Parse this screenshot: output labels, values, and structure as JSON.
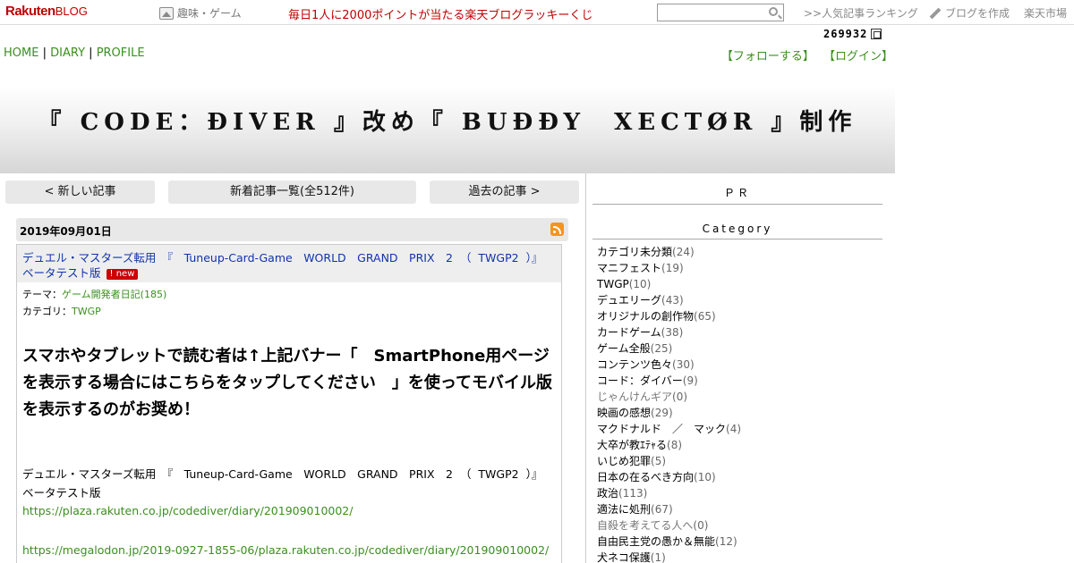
{
  "topbar": {
    "logo_main": "Rakuten",
    "logo_sub": "BLOG",
    "genre": "趣味・ゲーム",
    "promo": "毎日1人に2000ポイントが当たる楽天ブログラッキーくじ",
    "search_placeholder": "",
    "ranking": ">>人気記事ランキング",
    "create": "ブログを作成",
    "market": "楽天市場"
  },
  "counter": "269932",
  "nav": {
    "home": "HOME",
    "diary": "DIARY",
    "profile": "PROFILE",
    "sep": "|",
    "follow": "【フォローする】",
    "login": "【ログイン】"
  },
  "banner": {
    "title": "『 CODE：ÐIVER 』改め『 BUÐÐY　XECTØR 』制作"
  },
  "pagenav": {
    "newer": "< 新しい記事",
    "list": "新着記事一覧(全512件)",
    "older": "過去の記事 >"
  },
  "article": {
    "date": "2019年09月01日",
    "title": "デュエル・マスターズ転用　『　Tuneup-Card-Game　WORLD　GRAND　PRIX　2 （ TWGP2 ）』　ベータテスト版",
    "badge": "new",
    "theme_label": "テーマ：",
    "theme": "ゲーム開発者日記(185)",
    "category_label": "カテゴリ：",
    "category": "TWGP",
    "headline": "スマホやタブレットで読む者は↑上記バナー「　SmartPhone用ページを表示する場合にはこちらをタップしてください　」を使ってモバイル版を表示するのがお奨め！",
    "body": "デュエル・マスターズ転用　『　Tuneup-Card-Game　WORLD　GRAND　PRIX　2 （ TWGP2 ）』　ベータテスト版",
    "link1": "https://plaza.rakuten.co.jp/codediver/diary/201909010002/",
    "link2": "https://megalodon.jp/2019-0927-1855-06/plaza.rakuten.co.jp/codediver/diary/201909010002/"
  },
  "sidebar": {
    "pr": "ＰＲ",
    "category_heading": "Category",
    "categories": [
      {
        "name": "カテゴリ未分類",
        "count": "(24)"
      },
      {
        "name": "マニフェスト",
        "count": "(19)"
      },
      {
        "name": "TWGP",
        "count": "(10)"
      },
      {
        "name": "デュエリーグ",
        "count": "(43)"
      },
      {
        "name": "オリジナルの創作物",
        "count": "(65)"
      },
      {
        "name": "カードゲーム",
        "count": "(38)"
      },
      {
        "name": "ゲーム全般",
        "count": "(25)"
      },
      {
        "name": "コンテンツ色々",
        "count": "(30)"
      },
      {
        "name": "コード：ダイバー",
        "count": "(9)"
      },
      {
        "name": "じゃんけんギア",
        "count": "(0)"
      },
      {
        "name": "映画の感想",
        "count": "(29)"
      },
      {
        "name": "マクドナルド　／　マック",
        "count": "(4)"
      },
      {
        "name": "大卒が教ｴﾃｬる",
        "count": "(8)"
      },
      {
        "name": "いじめ犯罪",
        "count": "(5)"
      },
      {
        "name": "日本の在るべき方向",
        "count": "(10)"
      },
      {
        "name": "政治",
        "count": "(113)"
      },
      {
        "name": "適法に処刑",
        "count": "(67)"
      },
      {
        "name": "自殺を考えてる人へ",
        "count": "(0)"
      },
      {
        "name": "自由民主党の愚か＆無能",
        "count": "(12)"
      },
      {
        "name": "犬ネコ保護",
        "count": "(1)"
      }
    ]
  }
}
